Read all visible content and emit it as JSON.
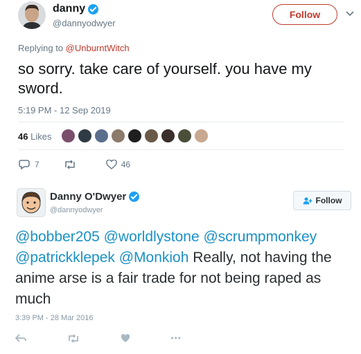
{
  "tweet1": {
    "author_name": "danny",
    "author_handle": "@dannyodwyer",
    "follow_label": "Follow",
    "replying_prefix": "Replying to ",
    "replying_handle": "@UnburntWitch",
    "text": "so sorry. take care of yourself. you have my sword.",
    "timestamp": "5:19 PM - 12 Sep 2019",
    "likes_count": "46",
    "likes_label": "Likes",
    "reply_count": "7",
    "like_count": "46",
    "colors": {
      "accent": "#c0392b",
      "verified": "#1da1f2"
    }
  },
  "tweet2": {
    "author_name": "Danny O'Dwyer",
    "author_handle": "@dannyodwyer",
    "follow_label": "Follow",
    "mentions_line1": "@bobber205 @worldlystone @scrumpmonkey",
    "mentions_line2": "@patrickklepek @Monkioh",
    "text_after_mentions": " Really, not having the anime arse is a fair trade for not being raped as much",
    "timestamp": "3:39 PM - 28 Mar 2016",
    "more_label": "•••",
    "colors": {
      "mention": "#1a91c7"
    }
  },
  "icons": {
    "verified": "verified-badge-icon",
    "chevron": "chevron-down-icon",
    "reply": "reply-icon",
    "retweet": "retweet-icon",
    "like": "heart-icon",
    "follow_person": "add-person-icon"
  }
}
